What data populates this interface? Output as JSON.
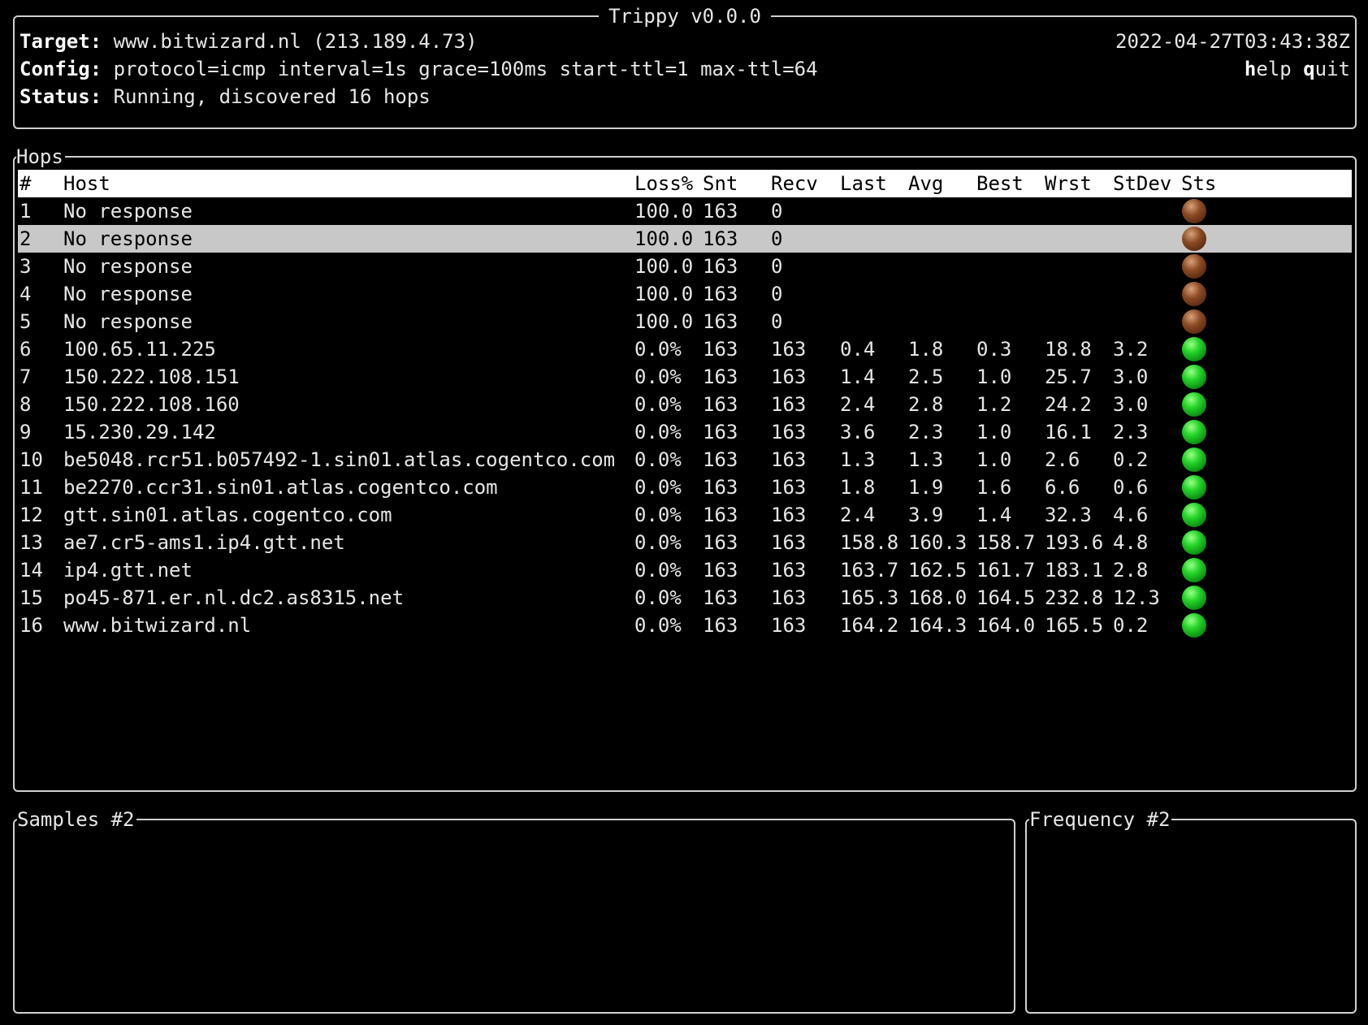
{
  "header": {
    "title": "Trippy v0.0.0",
    "target_label": "Target:",
    "target_value": " www.bitwizard.nl (213.189.4.73)",
    "config_label": "Config:",
    "config_value": " protocol=icmp interval=1s grace=100ms start-ttl=1 max-ttl=64",
    "status_label": "Status:",
    "status_value": " Running, discovered 16 hops",
    "timestamp": "2022-04-27T03:43:38Z",
    "help_key": "h",
    "help_rest": "elp",
    "quit_key": "q",
    "quit_rest": "uit"
  },
  "hops": {
    "title": "Hops",
    "columns": [
      "#",
      "Host",
      "Loss%",
      "Snt",
      "Recv",
      "Last",
      "Avg",
      "Best",
      "Wrst",
      "StDev",
      "Sts"
    ],
    "selected_row": 2,
    "rows": [
      {
        "num": "1",
        "host": "No response",
        "loss": "100.0",
        "snt": "163",
        "recv": "0",
        "last": "",
        "avg": "",
        "best": "",
        "wrst": "",
        "stdev": "",
        "status": "lost"
      },
      {
        "num": "2",
        "host": "No response",
        "loss": "100.0",
        "snt": "163",
        "recv": "0",
        "last": "",
        "avg": "",
        "best": "",
        "wrst": "",
        "stdev": "",
        "status": "lost"
      },
      {
        "num": "3",
        "host": "No response",
        "loss": "100.0",
        "snt": "163",
        "recv": "0",
        "last": "",
        "avg": "",
        "best": "",
        "wrst": "",
        "stdev": "",
        "status": "lost"
      },
      {
        "num": "4",
        "host": "No response",
        "loss": "100.0",
        "snt": "163",
        "recv": "0",
        "last": "",
        "avg": "",
        "best": "",
        "wrst": "",
        "stdev": "",
        "status": "lost"
      },
      {
        "num": "5",
        "host": "No response",
        "loss": "100.0",
        "snt": "163",
        "recv": "0",
        "last": "",
        "avg": "",
        "best": "",
        "wrst": "",
        "stdev": "",
        "status": "lost"
      },
      {
        "num": "6",
        "host": "100.65.11.225",
        "loss": "0.0%",
        "snt": "163",
        "recv": "163",
        "last": "0.4",
        "avg": "1.8",
        "best": "0.3",
        "wrst": "18.8",
        "stdev": "3.2",
        "status": "ok"
      },
      {
        "num": "7",
        "host": "150.222.108.151",
        "loss": "0.0%",
        "snt": "163",
        "recv": "163",
        "last": "1.4",
        "avg": "2.5",
        "best": "1.0",
        "wrst": "25.7",
        "stdev": "3.0",
        "status": "ok"
      },
      {
        "num": "8",
        "host": "150.222.108.160",
        "loss": "0.0%",
        "snt": "163",
        "recv": "163",
        "last": "2.4",
        "avg": "2.8",
        "best": "1.2",
        "wrst": "24.2",
        "stdev": "3.0",
        "status": "ok"
      },
      {
        "num": "9",
        "host": "15.230.29.142",
        "loss": "0.0%",
        "snt": "163",
        "recv": "163",
        "last": "3.6",
        "avg": "2.3",
        "best": "1.0",
        "wrst": "16.1",
        "stdev": "2.3",
        "status": "ok"
      },
      {
        "num": "10",
        "host": "be5048.rcr51.b057492-1.sin01.atlas.cogentco.com",
        "loss": "0.0%",
        "snt": "163",
        "recv": "163",
        "last": "1.3",
        "avg": "1.3",
        "best": "1.0",
        "wrst": "2.6",
        "stdev": "0.2",
        "status": "ok"
      },
      {
        "num": "11",
        "host": "be2270.ccr31.sin01.atlas.cogentco.com",
        "loss": "0.0%",
        "snt": "163",
        "recv": "163",
        "last": "1.8",
        "avg": "1.9",
        "best": "1.6",
        "wrst": "6.6",
        "stdev": "0.6",
        "status": "ok"
      },
      {
        "num": "12",
        "host": "gtt.sin01.atlas.cogentco.com",
        "loss": "0.0%",
        "snt": "163",
        "recv": "163",
        "last": "2.4",
        "avg": "3.9",
        "best": "1.4",
        "wrst": "32.3",
        "stdev": "4.6",
        "status": "ok"
      },
      {
        "num": "13",
        "host": "ae7.cr5-ams1.ip4.gtt.net",
        "loss": "0.0%",
        "snt": "163",
        "recv": "163",
        "last": "158.8",
        "avg": "160.3",
        "best": "158.7",
        "wrst": "193.6",
        "stdev": "4.8",
        "status": "ok"
      },
      {
        "num": "14",
        "host": "ip4.gtt.net",
        "loss": "0.0%",
        "snt": "163",
        "recv": "163",
        "last": "163.7",
        "avg": "162.5",
        "best": "161.7",
        "wrst": "183.1",
        "stdev": "2.8",
        "status": "ok"
      },
      {
        "num": "15",
        "host": "po45-871.er.nl.dc2.as8315.net",
        "loss": "0.0%",
        "snt": "163",
        "recv": "163",
        "last": "165.3",
        "avg": "168.0",
        "best": "164.5",
        "wrst": "232.8",
        "stdev": "12.3",
        "status": "ok"
      },
      {
        "num": "16",
        "host": "www.bitwizard.nl",
        "loss": "0.0%",
        "snt": "163",
        "recv": "163",
        "last": "164.2",
        "avg": "164.3",
        "best": "164.0",
        "wrst": "165.5",
        "stdev": "0.2",
        "status": "ok"
      }
    ]
  },
  "samples": {
    "title": "Samples #2"
  },
  "frequency": {
    "title": "Frequency #2"
  },
  "colors": {
    "ok_status": "#27d62a",
    "lost_status": "#8b4a24",
    "selected_row_bg": "#c8c8c8"
  }
}
